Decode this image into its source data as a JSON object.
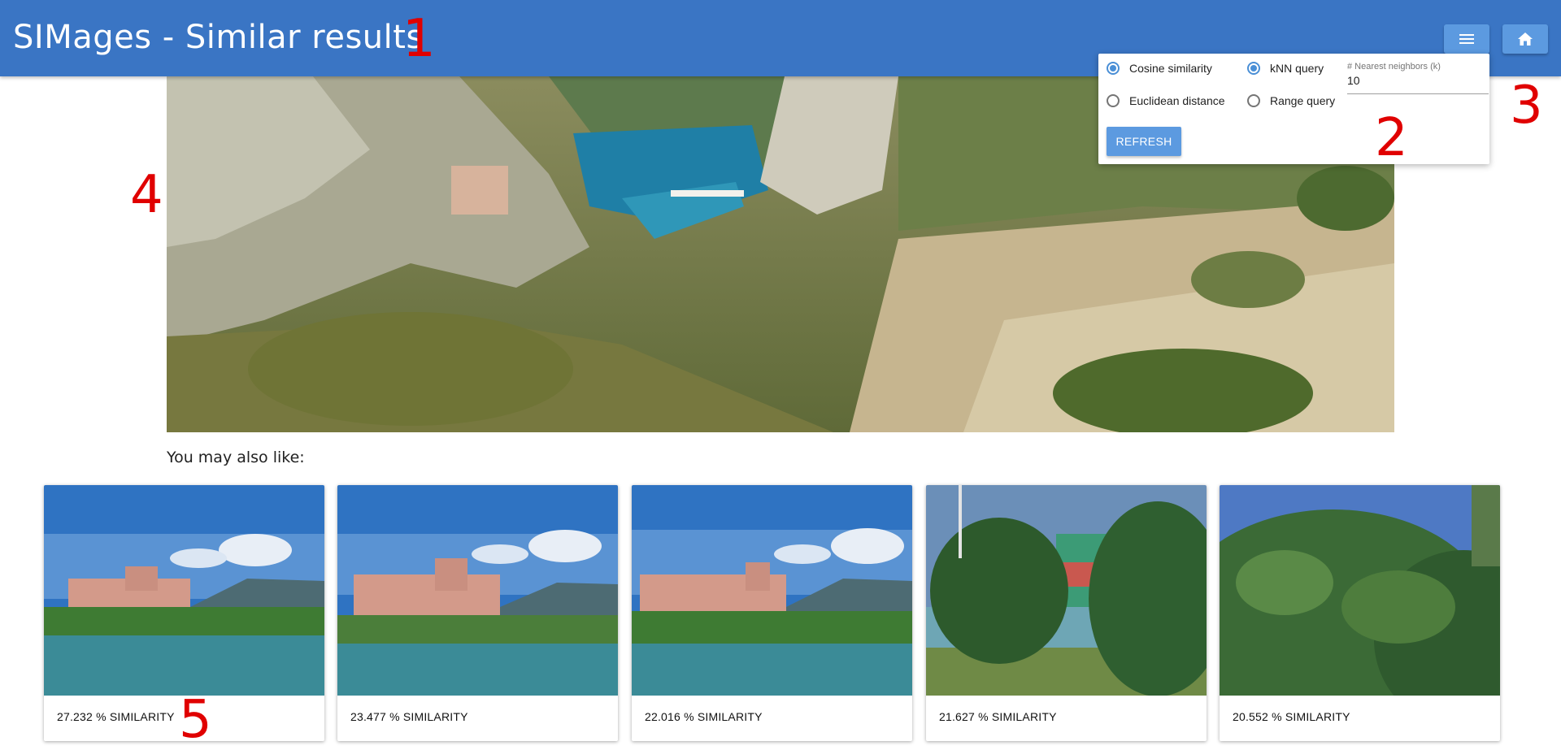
{
  "header": {
    "title": "SIMages - Similar results",
    "menu_icon": "menu-icon",
    "home_icon": "home-icon",
    "background": "#3a75c4"
  },
  "annotations": [
    "1",
    "2",
    "3",
    "4",
    "5"
  ],
  "settings": {
    "metrics": [
      {
        "label": "Cosine similarity",
        "checked": true
      },
      {
        "label": "Euclidean distance",
        "checked": false
      }
    ],
    "query_types": [
      {
        "label": "kNN query",
        "checked": true
      },
      {
        "label": "Range query",
        "checked": false
      }
    ],
    "k_label": "# Nearest neighbors (k)",
    "k_value": "10",
    "refresh_label": "REFRESH",
    "accent": "#4a8fd6"
  },
  "main": {
    "heading": "You may also like:",
    "results": [
      {
        "caption": "27.232 % SIMILARITY"
      },
      {
        "caption": "23.477 % SIMILARITY"
      },
      {
        "caption": "22.016 % SIMILARITY"
      },
      {
        "caption": "21.627 % SIMILARITY"
      },
      {
        "caption": "20.552 % SIMILARITY"
      }
    ]
  }
}
